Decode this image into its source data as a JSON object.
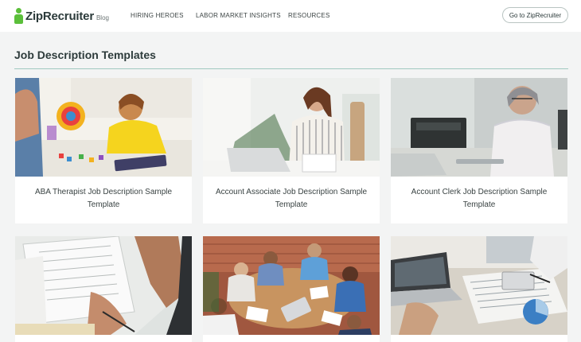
{
  "header": {
    "logo_name": "ZipRecruiter",
    "logo_sub": "Blog",
    "nav": [
      "HIRING HEROES",
      "LABOR MARKET INSIGHTS",
      "RESOURCES"
    ],
    "cta_label": "Go to ZipRecruiter"
  },
  "main": {
    "title": "Job Description Templates",
    "cards": [
      {
        "caption": "ABA Therapist Job Description Sample Template",
        "image": "child-playing-with-toys-photo"
      },
      {
        "caption": "Account Associate Job Description Sample Template",
        "image": "woman-at-desk-with-laptop-photo"
      },
      {
        "caption": "Account Clerk Job Description Sample Template",
        "image": "senior-woman-typing-photo"
      },
      {
        "caption": "",
        "image": "documents-and-pen-photo"
      },
      {
        "caption": "",
        "image": "team-meeting-around-table-photo"
      },
      {
        "caption": "",
        "image": "laptop-and-charts-desk-photo"
      }
    ]
  },
  "colors": {
    "brand_green": "#5bbf3a",
    "title_rule": "#9fc9c0",
    "page_bg": "#f3f4f4"
  }
}
